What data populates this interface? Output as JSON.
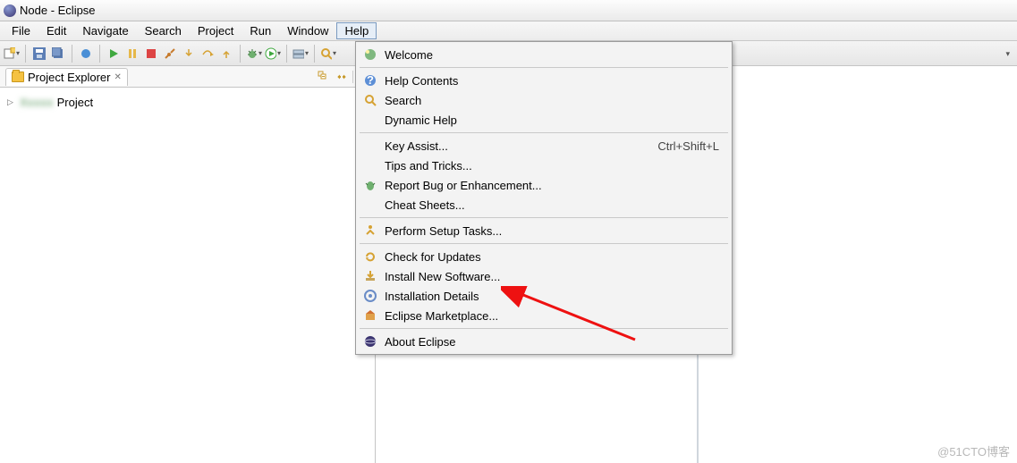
{
  "title": "Node - Eclipse",
  "menubar": [
    "File",
    "Edit",
    "Navigate",
    "Search",
    "Project",
    "Run",
    "Window",
    "Help"
  ],
  "open_menu_index": 7,
  "explorer": {
    "title": "Project Explorer",
    "tree_item_suffix": "Project"
  },
  "help_menu": {
    "groups": [
      [
        {
          "icon": "welcome",
          "label": "Welcome"
        }
      ],
      [
        {
          "icon": "help",
          "label": "Help Contents"
        },
        {
          "icon": "search",
          "label": "Search"
        },
        {
          "icon": "",
          "label": "Dynamic Help"
        }
      ],
      [
        {
          "icon": "",
          "label": "Key Assist...",
          "accel": "Ctrl+Shift+L"
        },
        {
          "icon": "",
          "label": "Tips and Tricks..."
        },
        {
          "icon": "bug",
          "label": "Report Bug or Enhancement..."
        },
        {
          "icon": "",
          "label": "Cheat Sheets..."
        }
      ],
      [
        {
          "icon": "setup",
          "label": "Perform Setup Tasks..."
        }
      ],
      [
        {
          "icon": "updates",
          "label": "Check for Updates"
        },
        {
          "icon": "install",
          "label": "Install New Software..."
        },
        {
          "icon": "details",
          "label": "Installation Details"
        },
        {
          "icon": "market",
          "label": "Eclipse Marketplace..."
        }
      ],
      [
        {
          "icon": "eclipse",
          "label": "About Eclipse"
        }
      ]
    ]
  },
  "watermark": "@51CTO博客"
}
